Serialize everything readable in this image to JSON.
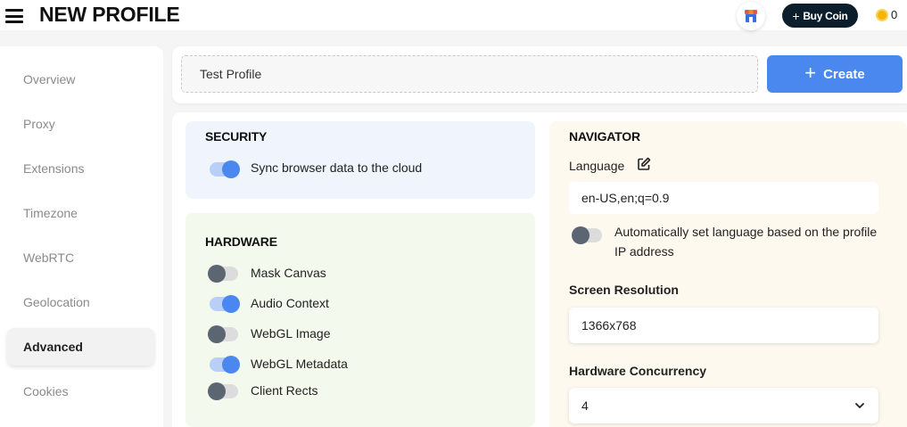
{
  "header": {
    "title": "NEW PROFILE",
    "buy_coin_label": "Buy Coin",
    "coin_balance": "0"
  },
  "sidebar": {
    "items": [
      {
        "label": "Overview",
        "active": false
      },
      {
        "label": "Proxy",
        "active": false
      },
      {
        "label": "Extensions",
        "active": false
      },
      {
        "label": "Timezone",
        "active": false
      },
      {
        "label": "WebRTC",
        "active": false
      },
      {
        "label": "Geolocation",
        "active": false
      },
      {
        "label": "Advanced",
        "active": true
      },
      {
        "label": "Cookies",
        "active": false
      }
    ]
  },
  "profile": {
    "name_value": "Test Profile",
    "create_label": "Create"
  },
  "security": {
    "title": "SECURITY",
    "sync_label": "Sync browser data to the cloud",
    "sync_on": true
  },
  "hardware": {
    "title": "HARDWARE",
    "options": [
      {
        "label": "Mask Canvas",
        "on": false
      },
      {
        "label": "Audio Context",
        "on": true
      },
      {
        "label": "WebGL Image",
        "on": false
      },
      {
        "label": "WebGL Metadata",
        "on": true
      },
      {
        "label": "Client Rects",
        "on": false
      }
    ]
  },
  "navigator": {
    "title": "NAVIGATOR",
    "language_label": "Language",
    "language_value": "en-US,en;q=0.9",
    "auto_language_label": "Automatically set language based on the profile IP address",
    "auto_language_on": false,
    "screen_resolution_label": "Screen Resolution",
    "screen_resolution_value": "1366x768",
    "hardware_concurrency_label": "Hardware Concurrency",
    "hardware_concurrency_value": "4"
  },
  "colors": {
    "accent": "#4a88f0",
    "buy_coin_bg": "#0c1e2c",
    "coin": "#f4b400"
  }
}
